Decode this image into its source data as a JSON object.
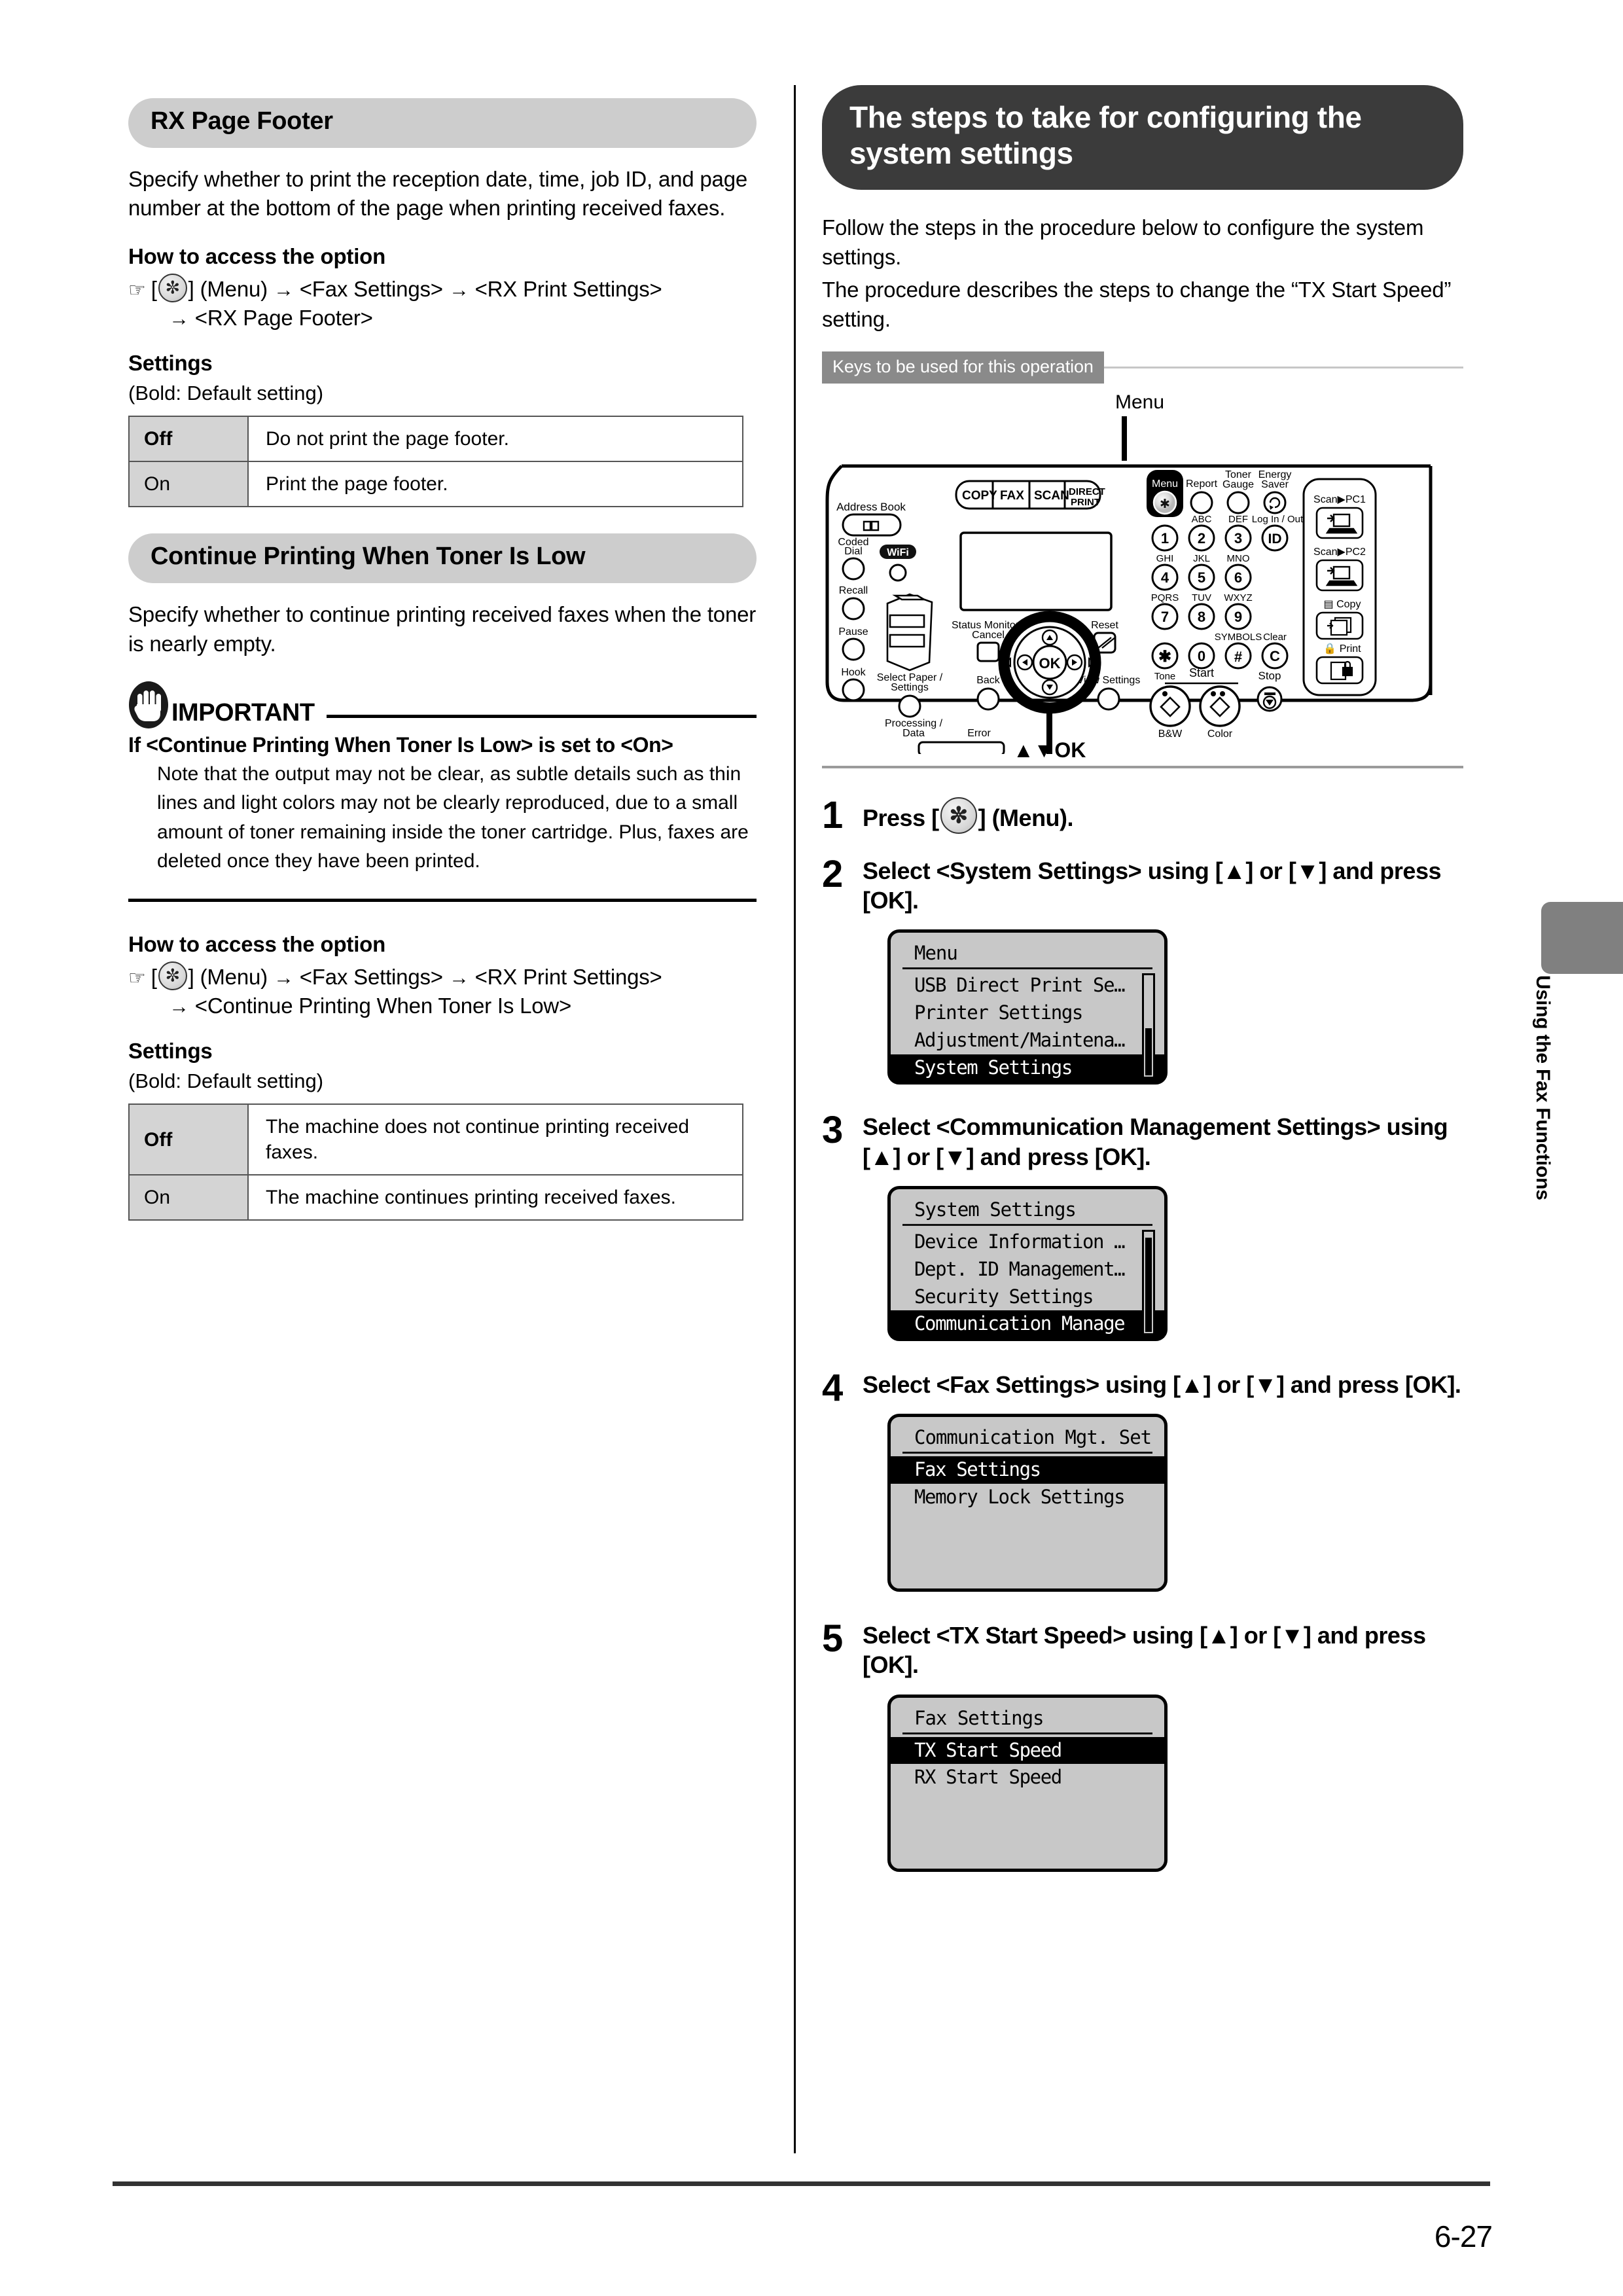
{
  "page": {
    "folio": "6-27",
    "side_tab_label": "Using the Fax Functions"
  },
  "left_column": {
    "section1": {
      "heading": "RX Page Footer",
      "description": "Specify whether to print the reception date, time, job ID, and page number at the bottom of the page when printing received faxes.",
      "access_heading": "How to access the option",
      "access_path_line1": "] (Menu)",
      "access_path_line1_rest": "<Fax Settings>",
      "access_path_line1_rest2": "<RX Print Settings>",
      "access_path_line2": "<RX Page Footer>",
      "settings_heading": "Settings",
      "settings_note": "(Bold: Default setting)",
      "table": {
        "rows": [
          {
            "key": "Off",
            "bold": true,
            "value": "Do not print the page footer."
          },
          {
            "key": "On",
            "bold": false,
            "value": "Print the page footer."
          }
        ]
      }
    },
    "section2": {
      "heading": "Continue Printing When Toner Is Low",
      "description": "Specify whether to continue printing received faxes when the toner is nearly empty.",
      "important": {
        "title": "IMPORTANT",
        "subtitle": "If <Continue Printing When Toner Is Low> is set to <On>",
        "body": "Note that the output may not be clear, as subtle details such as thin lines and light colors may not be clearly reproduced, due to a small amount of toner remaining inside the toner cartridge. Plus, faxes are deleted once they have been printed."
      },
      "access_heading": "How to access the option",
      "access_path_line1": "] (Menu)",
      "access_path_line1_rest": "<Fax Settings>",
      "access_path_line1_rest2": "<RX Print Settings>",
      "access_path_line2": "<Continue Printing When Toner Is Low>",
      "settings_heading": "Settings",
      "settings_note": "(Bold: Default setting)",
      "table": {
        "rows": [
          {
            "key": "Off",
            "bold": true,
            "value": "The machine does not continue printing received faxes."
          },
          {
            "key": "On",
            "bold": false,
            "value": "The machine continues printing received faxes."
          }
        ]
      }
    }
  },
  "right_column": {
    "heading": "The steps to take for configuring the system settings",
    "intro_line1": "Follow the steps in the procedure below to configure the system settings.",
    "intro_line2": "The procedure describes the steps to change the “TX Start Speed” setting.",
    "keys_bar_label": "Keys to be used for this operation",
    "panel": {
      "callout_top": "Menu",
      "callout_bottom": "▲▼OK",
      "mode_keys": [
        "COPY",
        "FAX",
        "SCAN",
        "DIRECT PRINT"
      ],
      "left_labels": [
        "Address Book",
        "Coded Dial",
        "Wi-Fi",
        "Recall",
        "Pause",
        "Hook",
        "Select Paper / Settings",
        "Processing / Data",
        "Error"
      ],
      "top_labels": [
        "Menu",
        "Report",
        "Toner Gauge",
        "Energy Saver"
      ],
      "keypad_letters": [
        "ABC",
        "DEF",
        "Log In / Out",
        "GHI",
        "JKL",
        "MNO",
        "PQRS",
        "TUV",
        "WXYZ",
        "SYMBOLS",
        "Clear"
      ],
      "keypad_digits": [
        "1",
        "2",
        "3",
        "ID",
        "4",
        "5",
        "6",
        "7",
        "8",
        "9",
        "✱",
        "0",
        "#",
        "C"
      ],
      "tone_label": "Tone",
      "start_label": "Start",
      "start_sub": [
        "B&W",
        "Color"
      ],
      "stop_label": "Stop",
      "nav_labels": [
        "Status Monitor / Cancel",
        "Reset",
        "Back",
        "View Settings",
        "OK"
      ],
      "right_keys": [
        "Scan▶PC1",
        "Scan▶PC2",
        "Copy",
        "Print"
      ]
    },
    "steps": [
      {
        "num": "1",
        "text_before": "Press [",
        "text_after": "] (Menu)."
      },
      {
        "num": "2",
        "text": "Select <System Settings> using [▲] or [▼] and press [OK].",
        "screen": {
          "title": "Menu",
          "rows": [
            {
              "label": "USB Direct Print Se…",
              "selected": false
            },
            {
              "label": "Printer Settings",
              "selected": false
            },
            {
              "label": "Adjustment/Maintena…",
              "selected": false
            },
            {
              "label": "System Settings",
              "selected": true
            }
          ],
          "scrollbar": true,
          "thumb_top_pct": 58,
          "thumb_height_pct": 40
        }
      },
      {
        "num": "3",
        "text": "Select <Communication Management Settings> using [▲] or [▼] and press [OK].",
        "screen": {
          "title": "System Settings",
          "rows": [
            {
              "label": "Device Information …",
              "selected": false
            },
            {
              "label": "Dept. ID Management…",
              "selected": false
            },
            {
              "label": "Security Settings",
              "selected": false
            },
            {
              "label": "Communication Manage",
              "selected": true
            }
          ],
          "scrollbar": true,
          "thumb_top_pct": 8,
          "thumb_height_pct": 90
        }
      },
      {
        "num": "4",
        "text": "Select <Fax Settings> using [▲] or [▼] and press [OK].",
        "screen": {
          "title": "Communication Mgt. Set",
          "rows": [
            {
              "label": "Fax Settings",
              "selected": true
            },
            {
              "label": "Memory Lock Settings",
              "selected": false
            }
          ],
          "scrollbar": false,
          "pad_bottom": true
        }
      },
      {
        "num": "5",
        "text": "Select <TX Start Speed> using [▲] or [▼] and press [OK].",
        "screen": {
          "title": "Fax Settings",
          "rows": [
            {
              "label": "TX Start Speed",
              "selected": true
            },
            {
              "label": "RX Start Speed",
              "selected": false
            }
          ],
          "scrollbar": false,
          "pad_bottom": true
        }
      }
    ]
  },
  "colors": {
    "pill_gray": "#cdcdcd",
    "pill_dark": "#3b3b3b",
    "keysbar_gray": "#8a8a8a",
    "lcd_bg": "#c8c8c8",
    "table_key_bg": "#d4d4d4",
    "side_tab": "#808080",
    "footer_bar": "#333333"
  }
}
